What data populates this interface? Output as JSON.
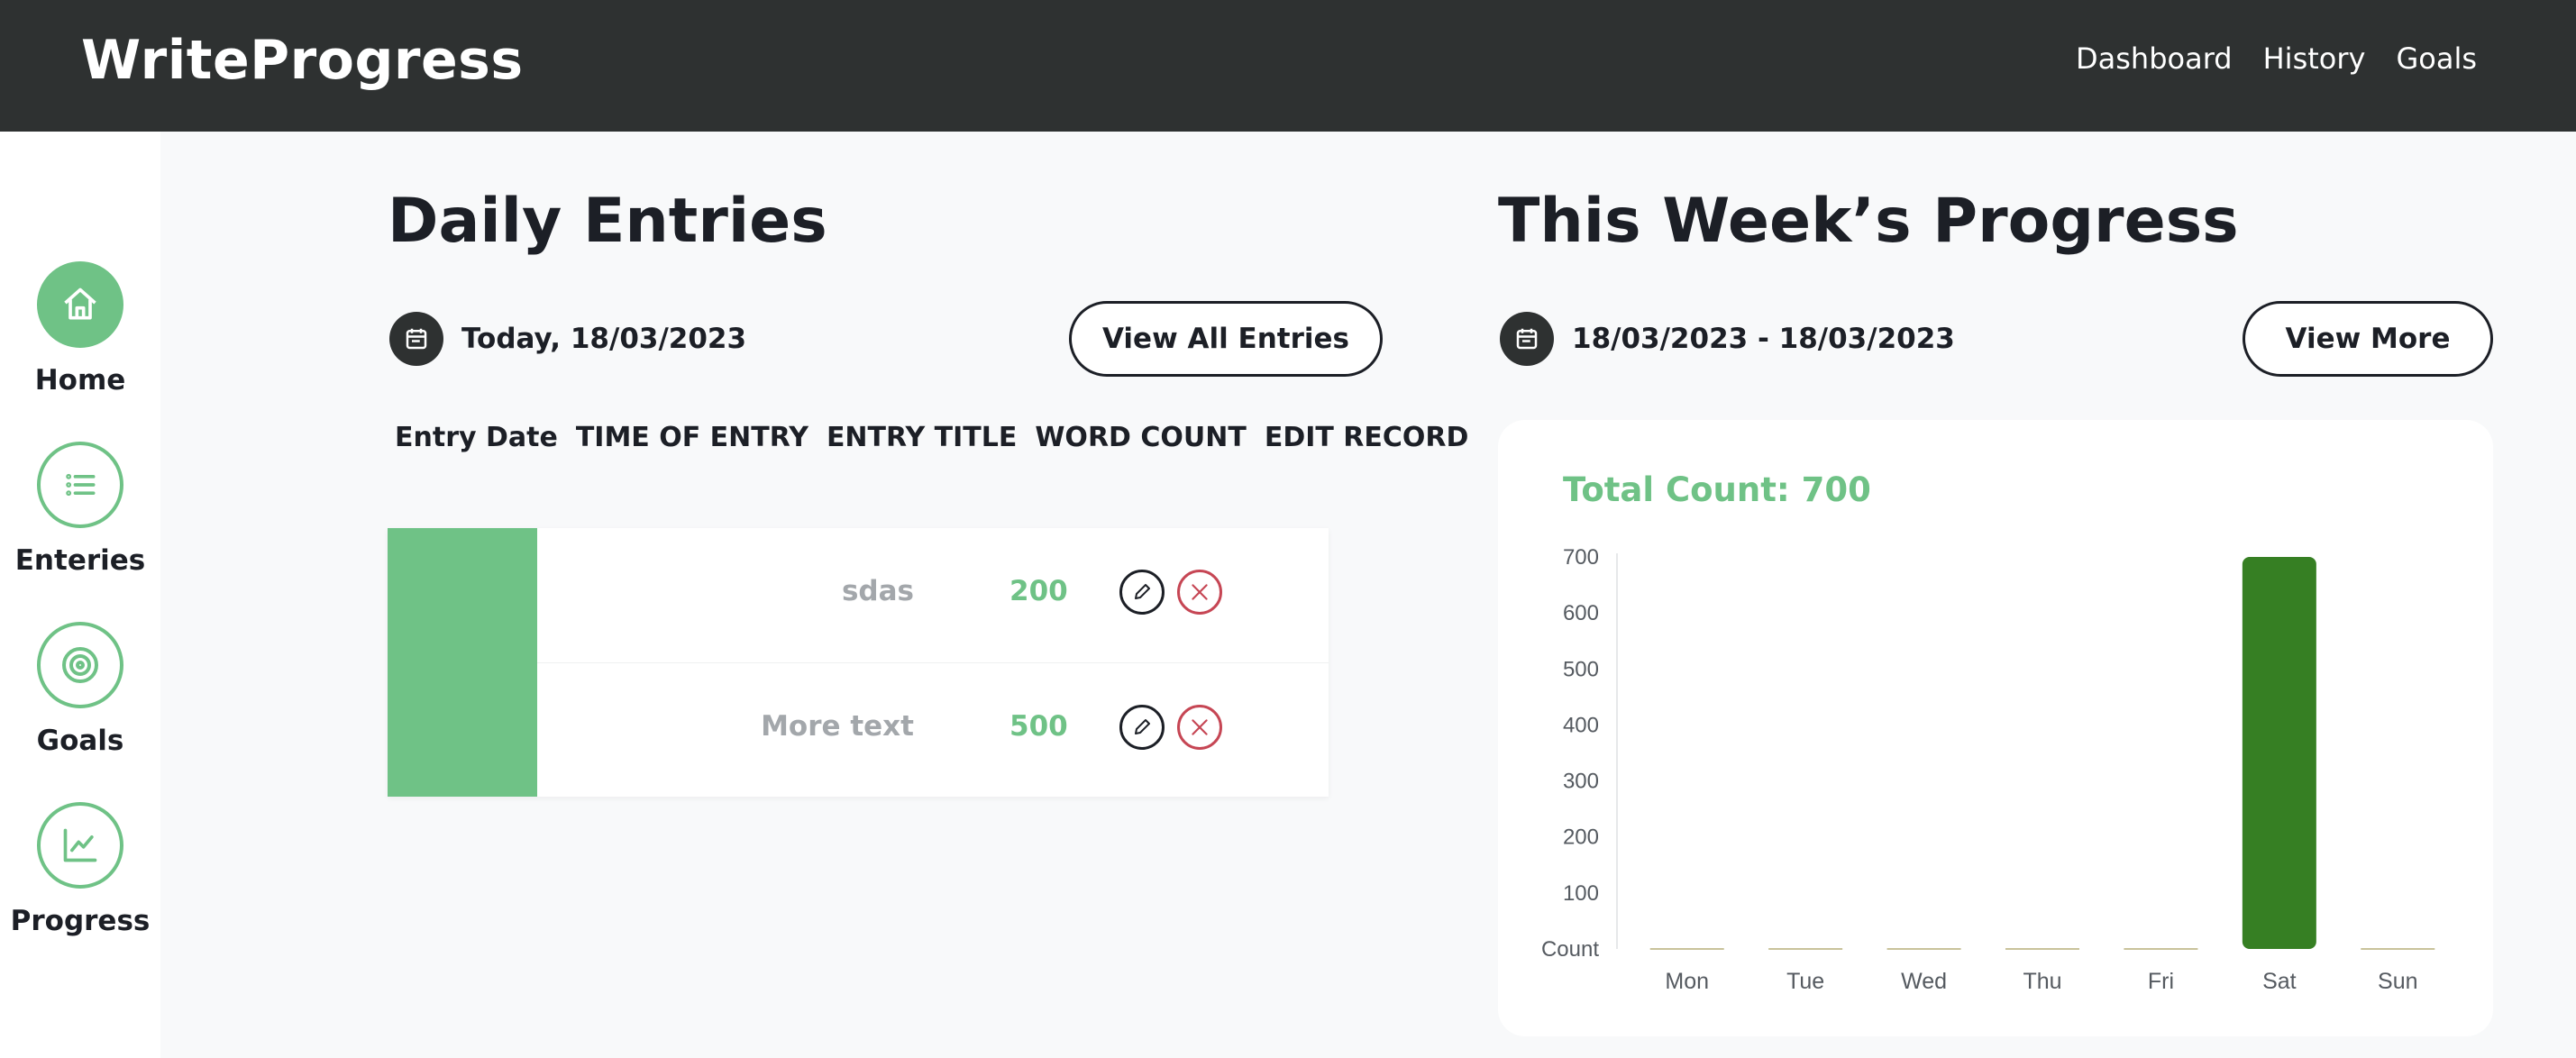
{
  "header": {
    "brand": "WriteProgress",
    "nav": [
      "Dashboard",
      "History",
      "Goals"
    ]
  },
  "sidebar": {
    "items": [
      {
        "label": "Home",
        "icon": "home-icon",
        "active": true
      },
      {
        "label": "Enteries",
        "icon": "list-icon",
        "active": false
      },
      {
        "label": "Goals",
        "icon": "target-icon",
        "active": false
      },
      {
        "label": "Progress",
        "icon": "chart-line-icon",
        "active": false
      }
    ]
  },
  "daily": {
    "title": "Daily Entries",
    "date": "Today, 18/03/2023",
    "view_all": "View All Entries",
    "columns": [
      "Entry Date",
      "TIME OF ENTRY",
      "ENTRY TITLE",
      "WORD COUNT",
      "EDIT RECORD"
    ],
    "rows": [
      {
        "title": "sdas",
        "count": "200"
      },
      {
        "title": "More text",
        "count": "500"
      }
    ]
  },
  "weekly": {
    "title": "This Week’s Progress",
    "range": "18/03/2023 - 18/03/2023",
    "view_more": "View More",
    "total": "Total Count: 700"
  },
  "colors": {
    "accent": "#6fc286",
    "bar": "#367f23",
    "dark": "#2e3131",
    "danger": "#c64654"
  },
  "chart_data": {
    "type": "bar",
    "categories": [
      "Mon",
      "Tue",
      "Wed",
      "Thu",
      "Fri",
      "Sat",
      "Sun"
    ],
    "values": [
      0,
      0,
      0,
      0,
      0,
      700,
      0
    ],
    "ylabel": "Count",
    "yticks": [
      100,
      200,
      300,
      400,
      500,
      600,
      700
    ],
    "ylim": [
      0,
      700
    ],
    "grid": false,
    "legend": "none"
  }
}
